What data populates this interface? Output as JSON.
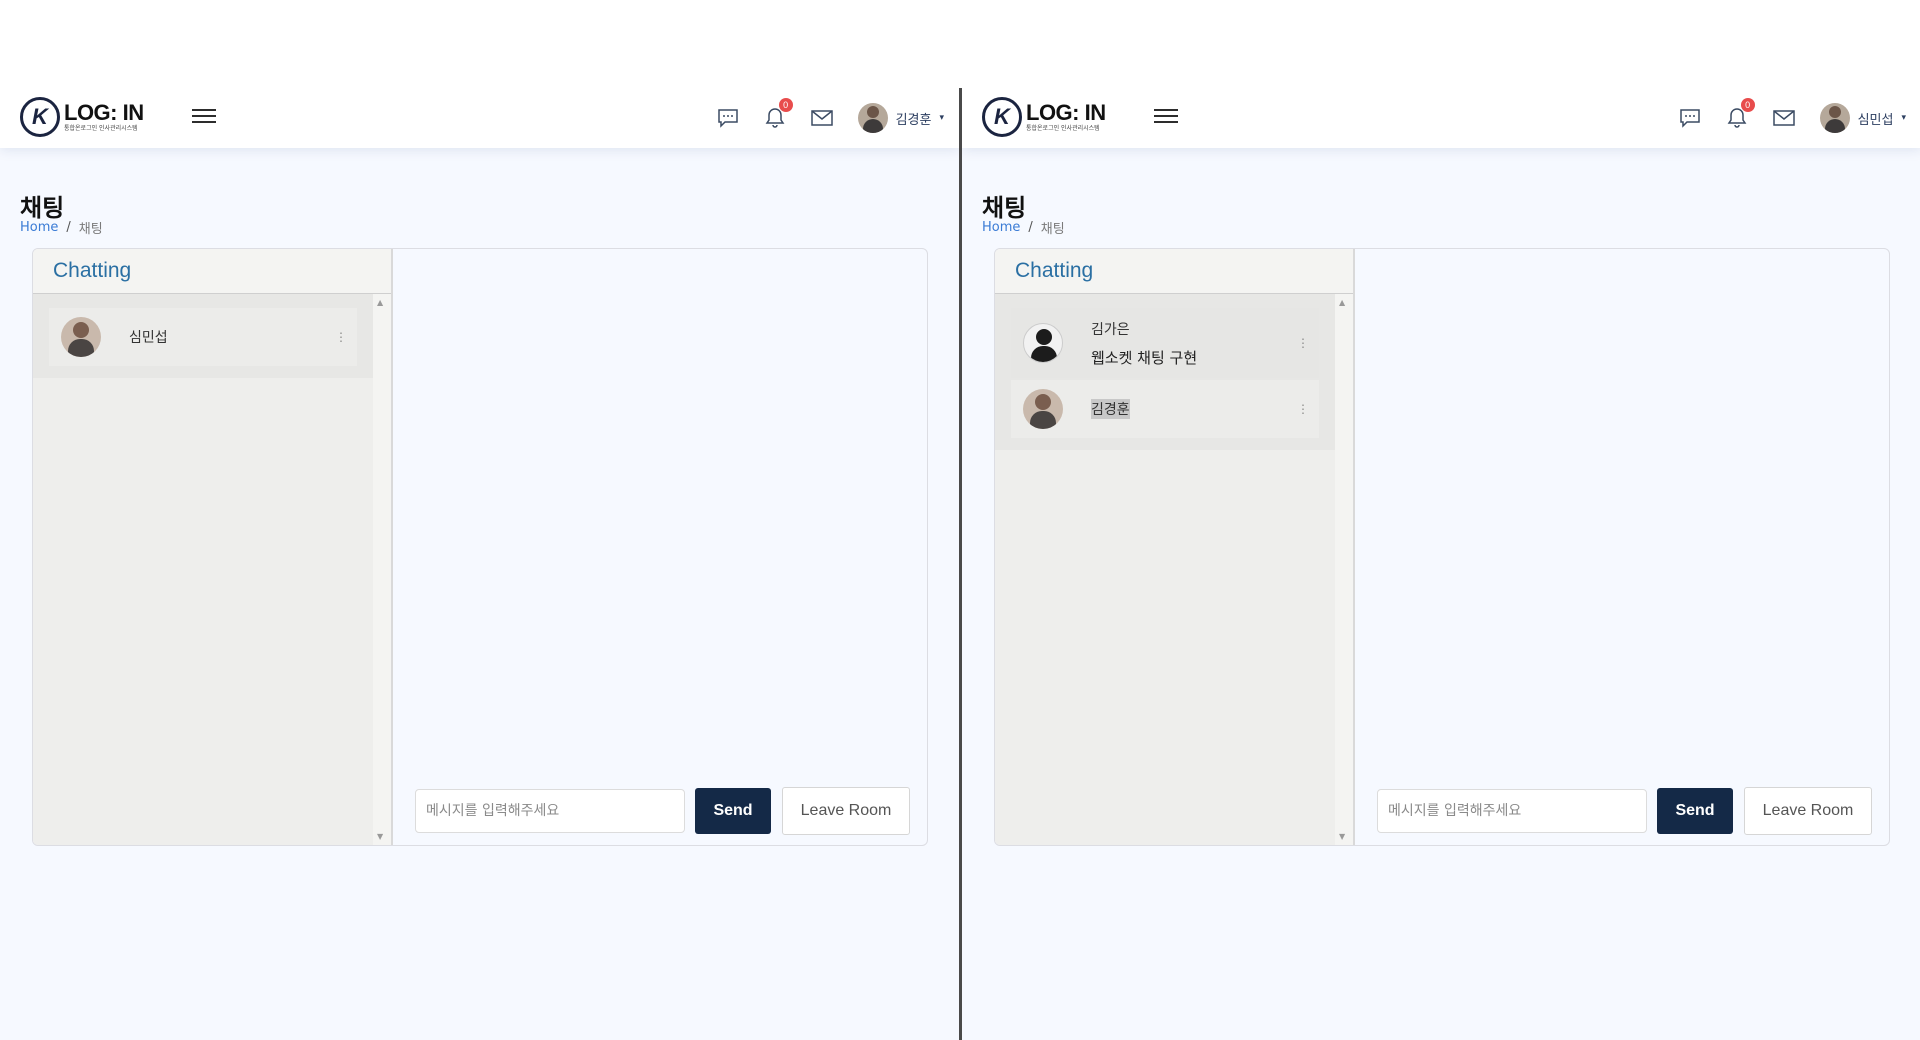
{
  "brand": {
    "logo_letters": "K",
    "title": "LOG: IN",
    "subtitle": "통합온로그인 인사관리시스템"
  },
  "panes": {
    "left": {
      "notifications_count": "0",
      "user_name": "김경훈",
      "page_title": "채팅",
      "breadcrumb": {
        "home": "Home",
        "separator": "/",
        "current": "채팅"
      },
      "card_header": "Chatting",
      "rooms": [
        {
          "name": "심민섭",
          "preview": ""
        }
      ],
      "input_placeholder": "메시지를 입력해주세요",
      "send_label": "Send",
      "leave_label": "Leave Room"
    },
    "right": {
      "notifications_count": "0",
      "user_name": "심민섭",
      "page_title": "채팅",
      "breadcrumb": {
        "home": "Home",
        "separator": "/",
        "current": "채팅"
      },
      "card_header": "Chatting",
      "rooms": [
        {
          "name": "김가은",
          "preview": "웹소켓 채팅 구현"
        },
        {
          "name": "김경훈",
          "preview": ""
        }
      ],
      "input_placeholder": "메시지를 입력해주세요",
      "send_label": "Send",
      "leave_label": "Leave Room"
    }
  },
  "icons": {
    "chat": "chat-icon",
    "bell": "bell-icon",
    "mail": "mail-icon",
    "menu": "menu-icon",
    "kebab": "kebab-icon",
    "kebab_glyph": "⋮",
    "scroll_up_glyph": "▲",
    "scroll_down_glyph": "▼",
    "caret_glyph": "▾"
  },
  "colors": {
    "accent_navy": "#142947",
    "link_blue": "#3a7bd5",
    "badge_red": "#e84c4c",
    "header_blue": "#2a6fa3"
  }
}
